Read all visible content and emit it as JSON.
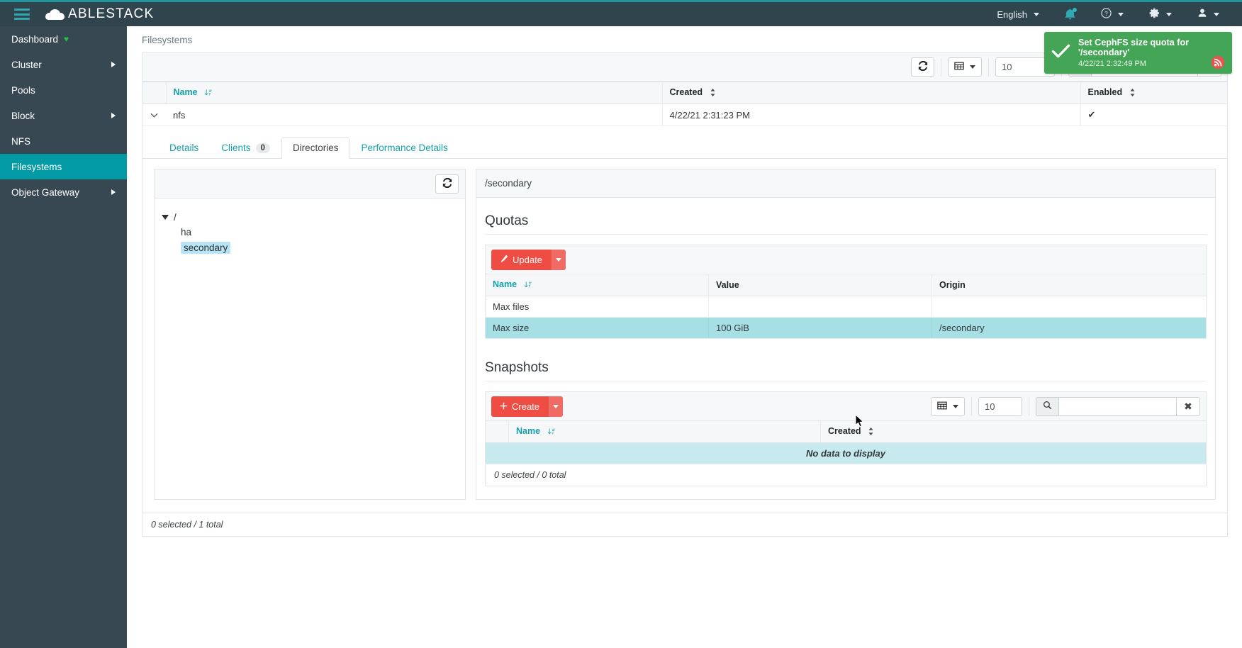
{
  "topbar": {
    "brand": "ABLESTACK",
    "language": "English",
    "icons": {
      "hamburger": "hamburger-icon",
      "bell": "notification-bell-icon",
      "help": "help-circle-icon",
      "settings": "gear-icon",
      "user": "user-icon"
    }
  },
  "sidebar": {
    "items": [
      {
        "label": "Dashboard",
        "heart": "♥",
        "expandable": false,
        "active": false
      },
      {
        "label": "Cluster",
        "expandable": true,
        "active": false
      },
      {
        "label": "Pools",
        "expandable": false,
        "active": false
      },
      {
        "label": "Block",
        "expandable": true,
        "active": false
      },
      {
        "label": "NFS",
        "expandable": false,
        "active": false
      },
      {
        "label": "Filesystems",
        "expandable": false,
        "active": true
      },
      {
        "label": "Object Gateway",
        "expandable": true,
        "active": false
      }
    ]
  },
  "breadcrumb": "Filesystems",
  "fs_table": {
    "toolbar": {
      "page_size": "10",
      "search_value": "",
      "refresh_icon": "refresh-icon",
      "columns_icon": "table-columns-icon",
      "search_icon": "search-icon",
      "clear_icon": "✖"
    },
    "columns": [
      "Name",
      "Created",
      "Enabled"
    ],
    "rows": [
      {
        "name": "nfs",
        "created": "4/22/21 2:31:23 PM",
        "enabled": "✔"
      }
    ],
    "footer": "0 selected / 1 total"
  },
  "tabs": [
    {
      "label": "Details",
      "badge": null,
      "active": false
    },
    {
      "label": "Clients",
      "badge": "0",
      "active": false
    },
    {
      "label": "Directories",
      "badge": null,
      "active": true
    },
    {
      "label": "Performance Details",
      "badge": null,
      "active": false
    }
  ],
  "tree": {
    "refresh_icon": "refresh-icon",
    "root": "/",
    "children": [
      {
        "label": "ha",
        "selected": false
      },
      {
        "label": "secondary",
        "selected": true
      }
    ]
  },
  "detail": {
    "path": "/secondary",
    "quotas": {
      "title": "Quotas",
      "update_label": "Update",
      "update_icon": "pencil-icon",
      "columns": [
        "Name",
        "Value",
        "Origin"
      ],
      "rows": [
        {
          "name": "Max files",
          "value": "",
          "origin": "",
          "highlighted": false
        },
        {
          "name": "Max size",
          "value": "100 GiB",
          "origin": "/secondary",
          "highlighted": true
        }
      ]
    },
    "snapshots": {
      "title": "Snapshots",
      "create_label": "Create",
      "create_icon": "plus-icon",
      "toolbar": {
        "page_size": "10",
        "search_value": "",
        "columns_icon": "table-columns-icon",
        "search_icon": "search-icon",
        "clear_icon": "✖"
      },
      "columns": [
        "Name",
        "Created"
      ],
      "empty_text": "No data to display",
      "footer": "0 selected / 0 total"
    }
  },
  "toast": {
    "title": "Set CephFS size quota for '/secondary'",
    "time": "4/22/21 2:32:49 PM",
    "check_icon": "check-icon",
    "rss_icon": "rss-icon",
    "color": "#45a557"
  }
}
